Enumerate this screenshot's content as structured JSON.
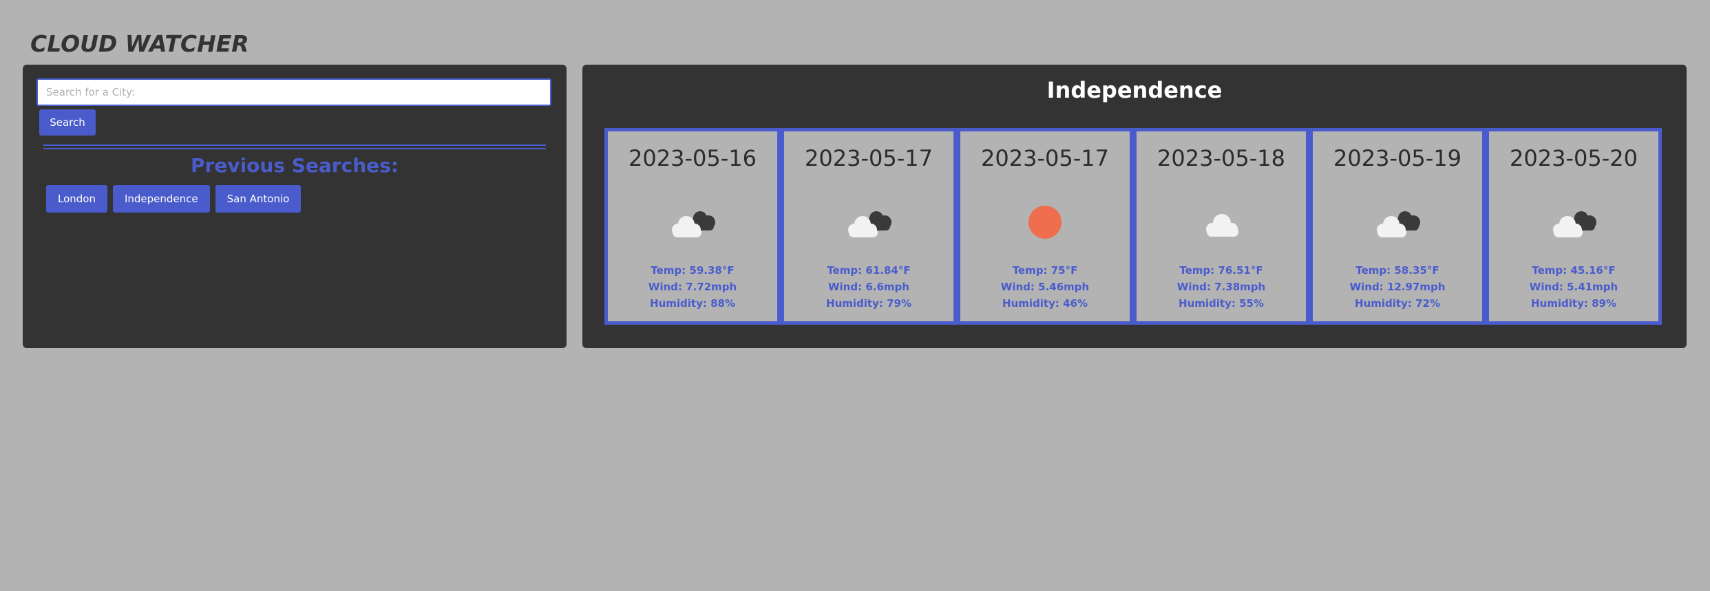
{
  "app": {
    "title": "CLOUD WATCHER"
  },
  "search": {
    "placeholder": "Search for a City:",
    "value": "",
    "button_label": "Search"
  },
  "history": {
    "heading": "Previous Searches:",
    "items": [
      "London",
      "Independence",
      "San Antonio"
    ]
  },
  "forecast": {
    "city": "Independence",
    "days": [
      {
        "date": "2023-05-16",
        "icon": "scattered-clouds-icon",
        "temp": "Temp: 59.38°F",
        "wind": "Wind: 7.72mph",
        "humidity": "Humidity: 88%"
      },
      {
        "date": "2023-05-17",
        "icon": "scattered-clouds-icon",
        "temp": "Temp: 61.84°F",
        "wind": "Wind: 6.6mph",
        "humidity": "Humidity: 79%"
      },
      {
        "date": "2023-05-17",
        "icon": "clear-sky-sun-icon",
        "temp": "Temp: 75°F",
        "wind": "Wind: 5.46mph",
        "humidity": "Humidity: 46%"
      },
      {
        "date": "2023-05-18",
        "icon": "few-clouds-icon",
        "temp": "Temp: 76.51°F",
        "wind": "Wind: 7.38mph",
        "humidity": "Humidity: 55%"
      },
      {
        "date": "2023-05-19",
        "icon": "scattered-clouds-icon",
        "temp": "Temp: 58.35°F",
        "wind": "Wind: 12.97mph",
        "humidity": "Humidity: 72%"
      },
      {
        "date": "2023-05-20",
        "icon": "scattered-clouds-icon",
        "temp": "Temp: 45.16°F",
        "wind": "Wind: 5.41mph",
        "humidity": "Humidity: 89%"
      }
    ]
  },
  "colors": {
    "background": "#b3b3b3",
    "panel": "#333333",
    "accent": "#4a5ccc",
    "sun": "#ee6e4d",
    "cloud_light": "#f2f2f2",
    "cloud_dark": "#3a3a3a"
  }
}
